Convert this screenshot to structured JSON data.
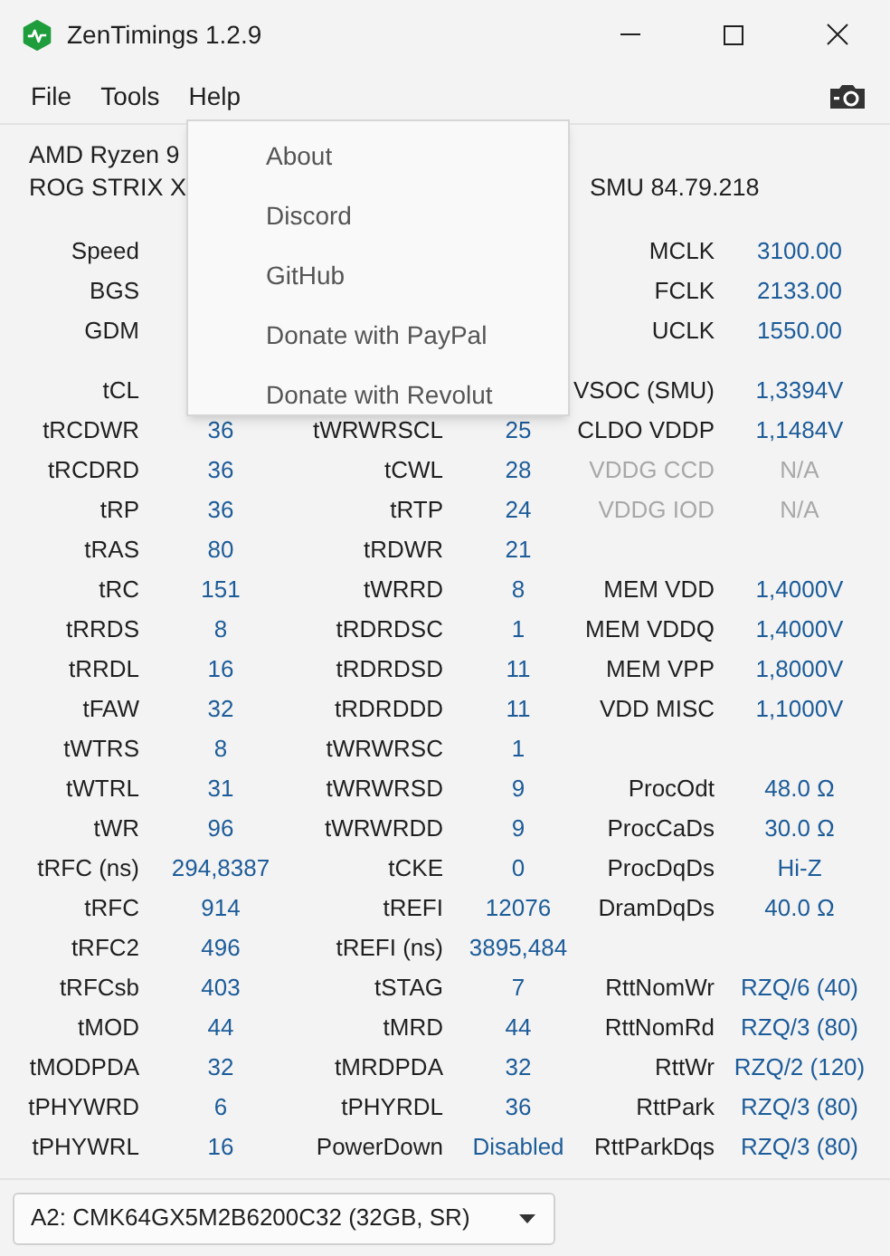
{
  "window": {
    "title": "ZenTimings 1.2.9"
  },
  "menu_bar": [
    {
      "label": "File"
    },
    {
      "label": "Tools"
    },
    {
      "label": "Help"
    }
  ],
  "help_menu": [
    {
      "label": "About"
    },
    {
      "label": "Discord"
    },
    {
      "label": "GitHub"
    },
    {
      "label": "Donate with PayPal"
    },
    {
      "label": "Donate with Revolut"
    }
  ],
  "system_info": [
    {
      "segments": [
        "AMD Ryzen 9"
      ]
    },
    {
      "segments": [
        "ROG STRIX X",
        "SMU 84.79.218"
      ]
    }
  ],
  "groups": [
    [
      {
        "col_1": {
          "label": "Speed",
          "disabled": false
        },
        "col_3": {
          "label": "MCLK",
          "value": "3100.00",
          "disabled": false
        }
      },
      {
        "col_1": {
          "label": "BGS",
          "disabled": false
        },
        "col_3": {
          "label": "FCLK",
          "value": "2133.00",
          "disabled": false
        }
      },
      {
        "col_1": {
          "label": "GDM",
          "disabled": false
        },
        "col_3": {
          "label": "UCLK",
          "value": "1550.00",
          "disabled": false
        }
      }
    ],
    [
      {
        "col_1": {
          "label": "tCL",
          "disabled": false
        },
        "col_3": {
          "label": "VSOC (SMU)",
          "value": "1,3394V",
          "disabled": false
        }
      },
      {
        "col_1": {
          "label": "tRCDWR",
          "value": "36",
          "disabled": false
        },
        "col_2": {
          "label": "tWRWRSCL",
          "value": "25",
          "disabled": false
        },
        "col_3": {
          "label": "CLDO VDDP",
          "value": "1,1484V",
          "disabled": false
        }
      },
      {
        "col_1": {
          "label": "tRCDRD",
          "value": "36",
          "disabled": false
        },
        "col_2": {
          "label": "tCWL",
          "value": "28",
          "disabled": false
        },
        "col_3": {
          "label": "VDDG CCD",
          "value": "N/A",
          "disabled": true
        }
      },
      {
        "col_1": {
          "label": "tRP",
          "value": "36",
          "disabled": false
        },
        "col_2": {
          "label": "tRTP",
          "value": "24",
          "disabled": false
        },
        "col_3": {
          "label": "VDDG IOD",
          "value": "N/A",
          "disabled": true
        }
      },
      {
        "col_1": {
          "label": "tRAS",
          "value": "80",
          "disabled": false
        },
        "col_2": {
          "label": "tRDWR",
          "value": "21",
          "disabled": false
        }
      },
      {
        "col_1": {
          "label": "tRC",
          "value": "151",
          "disabled": false
        },
        "col_2": {
          "label": "tWRRD",
          "value": "8",
          "disabled": false
        },
        "col_3": {
          "label": "MEM VDD",
          "value": "1,4000V",
          "disabled": false
        }
      },
      {
        "col_1": {
          "label": "tRRDS",
          "value": "8",
          "disabled": false
        },
        "col_2": {
          "label": "tRDRDSC",
          "value": "1",
          "disabled": false
        },
        "col_3": {
          "label": "MEM VDDQ",
          "value": "1,4000V",
          "disabled": false
        }
      },
      {
        "col_1": {
          "label": "tRRDL",
          "value": "16",
          "disabled": false
        },
        "col_2": {
          "label": "tRDRDSD",
          "value": "11",
          "disabled": false
        },
        "col_3": {
          "label": "MEM VPP",
          "value": "1,8000V",
          "disabled": false
        }
      },
      {
        "col_1": {
          "label": "tFAW",
          "value": "32",
          "disabled": false
        },
        "col_2": {
          "label": "tRDRDDD",
          "value": "11",
          "disabled": false
        },
        "col_3": {
          "label": "VDD MISC",
          "value": "1,1000V",
          "disabled": false
        }
      },
      {
        "col_1": {
          "label": "tWTRS",
          "value": "8",
          "disabled": false
        },
        "col_2": {
          "label": "tWRWRSC",
          "value": "1",
          "disabled": false
        }
      },
      {
        "col_1": {
          "label": "tWTRL",
          "value": "31",
          "disabled": false
        },
        "col_2": {
          "label": "tWRWRSD",
          "value": "9",
          "disabled": false
        },
        "col_3": {
          "label": "ProcOdt",
          "value": "48.0 Ω",
          "disabled": false
        }
      },
      {
        "col_1": {
          "label": "tWR",
          "value": "96",
          "disabled": false
        },
        "col_2": {
          "label": "tWRWRDD",
          "value": "9",
          "disabled": false
        },
        "col_3": {
          "label": "ProcCaDs",
          "value": "30.0 Ω",
          "disabled": false
        }
      },
      {
        "col_1": {
          "label": "tRFC (ns)",
          "value": "294,8387",
          "disabled": false
        },
        "col_2": {
          "label": "tCKE",
          "value": "0",
          "disabled": false
        },
        "col_3": {
          "label": "ProcDqDs",
          "value": "Hi-Z",
          "disabled": false
        }
      },
      {
        "col_1": {
          "label": "tRFC",
          "value": "914",
          "disabled": false
        },
        "col_2": {
          "label": "tREFI",
          "value": "12076",
          "disabled": false
        },
        "col_3": {
          "label": "DramDqDs",
          "value": "40.0 Ω",
          "disabled": false
        }
      },
      {
        "col_1": {
          "label": "tRFC2",
          "value": "496",
          "disabled": false
        },
        "col_2": {
          "label": "tREFI (ns)",
          "value": "3895,484",
          "disabled": false
        }
      },
      {
        "col_1": {
          "label": "tRFCsb",
          "value": "403",
          "disabled": false
        },
        "col_2": {
          "label": "tSTAG",
          "value": "7",
          "disabled": false
        },
        "col_3": {
          "label": "RttNomWr",
          "value": "RZQ/6 (40)",
          "disabled": false
        }
      },
      {
        "col_1": {
          "label": "tMOD",
          "value": "44",
          "disabled": false
        },
        "col_2": {
          "label": "tMRD",
          "value": "44",
          "disabled": false
        },
        "col_3": {
          "label": "RttNomRd",
          "value": "RZQ/3 (80)",
          "disabled": false
        }
      },
      {
        "col_1": {
          "label": "tMODPDA",
          "value": "32",
          "disabled": false
        },
        "col_2": {
          "label": "tMRDPDA",
          "value": "32",
          "disabled": false
        },
        "col_3": {
          "label": "RttWr",
          "value": "RZQ/2 (120)",
          "disabled": false
        }
      },
      {
        "col_1": {
          "label": "tPHYWRD",
          "value": "6",
          "disabled": false
        },
        "col_2": {
          "label": "tPHYRDL",
          "value": "36",
          "disabled": false
        },
        "col_3": {
          "label": "RttPark",
          "value": "RZQ/3 (80)",
          "disabled": false
        }
      },
      {
        "col_1": {
          "label": "tPHYWRL",
          "value": "16",
          "disabled": false
        },
        "col_2": {
          "label": "PowerDown",
          "value": "Disabled",
          "disabled": false
        },
        "col_3": {
          "label": "RttParkDqs",
          "value": "RZQ/3 (80)",
          "disabled": false
        }
      }
    ]
  ],
  "module_select": {
    "value": "A2: CMK64GX5M2B6200C32 (32GB, SR)"
  }
}
